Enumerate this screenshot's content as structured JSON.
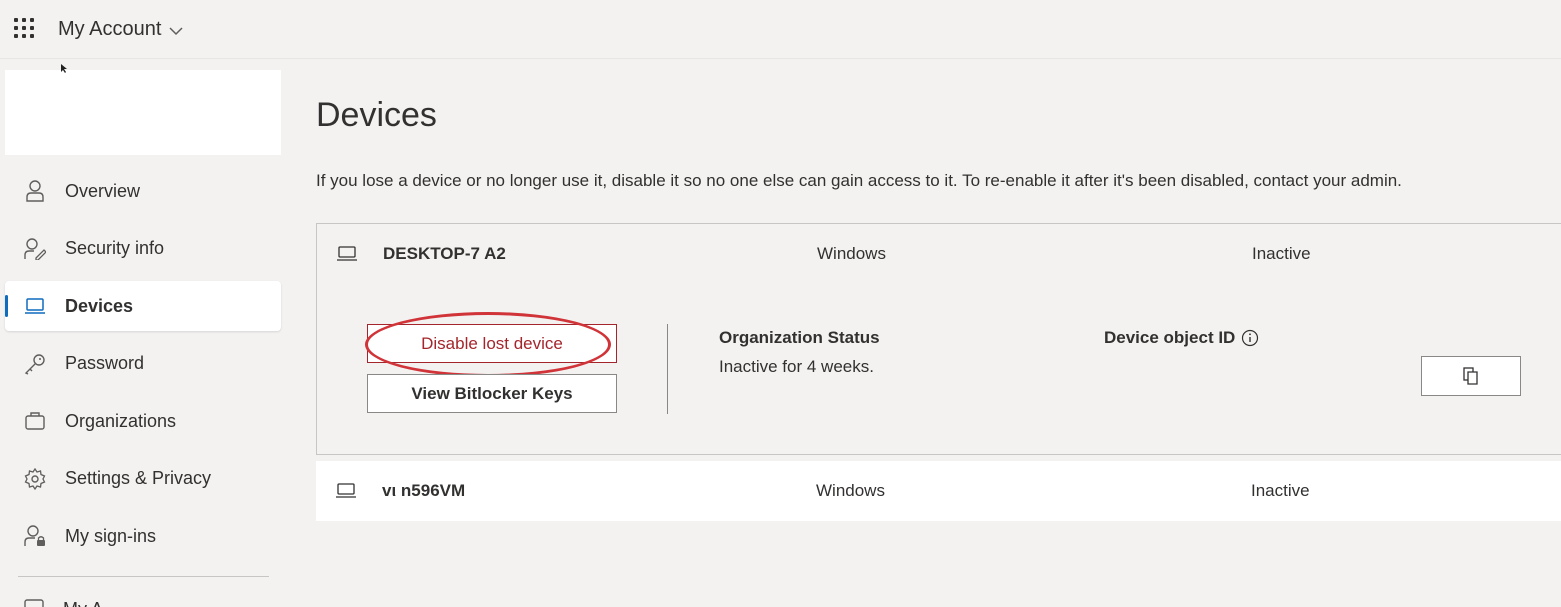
{
  "header": {
    "app_title": "My Account",
    "waffle_icon": "app-launcher-icon",
    "dropdown_icon": "chevron-down-icon"
  },
  "sidebar": {
    "items": [
      {
        "label": "Overview",
        "icon": "person-icon"
      },
      {
        "label": "Security info",
        "icon": "person-edit-icon"
      },
      {
        "label": "Devices",
        "icon": "laptop-icon",
        "active": true
      },
      {
        "label": "Password",
        "icon": "key-icon"
      },
      {
        "label": "Organizations",
        "icon": "briefcase-icon"
      },
      {
        "label": "Settings & Privacy",
        "icon": "gear-icon"
      },
      {
        "label": "My sign-ins",
        "icon": "person-lock-icon"
      }
    ],
    "partial_item": {
      "label": "My A",
      "icon": "apps-icon"
    },
    "accent_color": "#0f6cbd"
  },
  "main": {
    "title": "Devices",
    "description": "If you lose a device or no longer use it, disable it so no one else can gain access to it. To re-enable it after it's been disabled, contact your admin.",
    "devices": [
      {
        "name": "DESKTOP-7        A2",
        "os": "Windows",
        "status": "Inactive",
        "expanded": true,
        "disable_button": "Disable lost device",
        "bitlocker_button": "View Bitlocker Keys",
        "org_status_label": "Organization Status",
        "org_status_value": "Inactive for 4 weeks.",
        "object_id_label": "Device object ID"
      },
      {
        "name": "vι      n596VM",
        "os": "Windows",
        "status": "Inactive",
        "expanded": false
      }
    ],
    "highlight_color": "#d13438",
    "danger_color": "#a4262c"
  }
}
